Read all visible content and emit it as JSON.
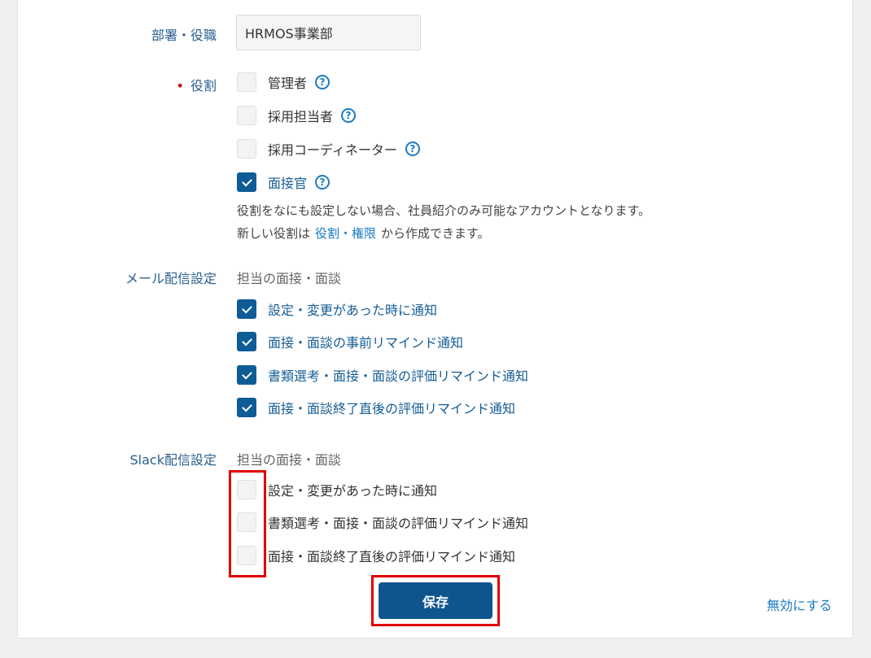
{
  "department": {
    "label": "部署・役職",
    "value": "HRMOS事業部"
  },
  "roles": {
    "label": "役割",
    "required_mark": "•",
    "options": [
      {
        "label": "管理者",
        "checked": false,
        "help_icon": "question-circle-icon"
      },
      {
        "label": "採用担当者",
        "checked": false,
        "help_icon": "question-circle-icon"
      },
      {
        "label": "採用コーディネーター",
        "checked": false,
        "help_icon": "question-circle-icon"
      },
      {
        "label": "面接官",
        "checked": true,
        "help_icon": "question-circle-icon"
      }
    ],
    "help_glyph": "?",
    "note_line1": "役割をなにも設定しない場合、社員紹介のみ可能なアカウントとなります。",
    "note_line2_prefix": "新しい役割は",
    "note_line2_link": "役割・権限",
    "note_line2_suffix": "から作成できます。"
  },
  "mail": {
    "label": "メール配信設定",
    "subheading": "担当の面接・面談",
    "options": [
      {
        "label": "設定・変更があった時に通知",
        "checked": true
      },
      {
        "label": "面接・面談の事前リマインド通知",
        "checked": true
      },
      {
        "label": "書類選考・面接・面談の評価リマインド通知",
        "checked": true
      },
      {
        "label": "面接・面談終了直後の評価リマインド通知",
        "checked": true
      }
    ]
  },
  "slack": {
    "label": "Slack配信設定",
    "subheading": "担当の面接・面談",
    "options": [
      {
        "label": "設定・変更があった時に通知",
        "checked": false
      },
      {
        "label": "書類選考・面接・面談の評価リマインド通知",
        "checked": false
      },
      {
        "label": "面接・面談終了直後の評価リマインド通知",
        "checked": false
      }
    ]
  },
  "actions": {
    "save_label": "保存",
    "disable_label": "無効にする"
  },
  "colors": {
    "accent": "#0e5c96",
    "link": "#1a7cc1",
    "label": "#2a5f8f",
    "highlight": "#e00000",
    "required": "#cc0000"
  }
}
